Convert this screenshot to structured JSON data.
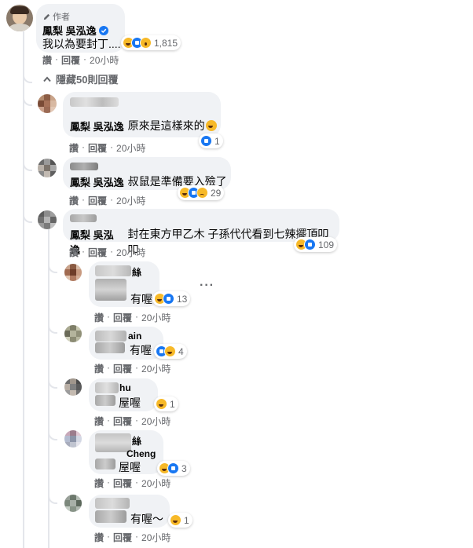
{
  "root": {
    "author_badge": "作者",
    "name": "鳳梨 吳泓逸",
    "text": "我以為要封丁....",
    "reactions": "1,815",
    "actions": {
      "like": "讚",
      "reply": "回覆",
      "time": "20小時"
    }
  },
  "hide_replies": "隱藏50則回覆",
  "comments": [
    {
      "mention": "鳳梨 吳泓逸",
      "text": "原來是這樣來的",
      "reactions": "1",
      "like": "讚",
      "reply": "回覆",
      "time": "20小時"
    },
    {
      "mention": "鳳梨 吳泓逸",
      "text": "叔鼠是準備要入殮了",
      "reactions": "29",
      "like": "讚",
      "reply": "回覆",
      "time": "20小時"
    },
    {
      "mention": "鳳梨 吳泓逸",
      "text": "封在東方甲乙木 子孫代代看到七辣擺頂叩叩",
      "reactions": "109",
      "like": "讚",
      "reply": "回覆",
      "time": "20小時"
    }
  ],
  "replies": [
    {
      "name_fragment": "絲",
      "text": "有喔",
      "reactions": "13",
      "like": "讚",
      "reply": "回覆",
      "time": "20小時"
    },
    {
      "name_fragment": "ain",
      "text": "有喔",
      "reactions": "4",
      "like": "讚",
      "reply": "回覆",
      "time": "20小時"
    },
    {
      "name_fragment": "hu",
      "text": "屋喔",
      "reactions": "1",
      "like": "讚",
      "reply": "回覆",
      "time": "20小時"
    },
    {
      "name_fragment": "絲",
      "name_fragment2": "Cheng",
      "text": "屋喔",
      "reactions": "3",
      "like": "讚",
      "reply": "回覆",
      "time": "20小時"
    },
    {
      "name_fragment": "",
      "text": "有喔～",
      "reactions": "1",
      "like": "讚",
      "reply": "回覆",
      "time": "20小時"
    }
  ],
  "colors": {
    "bubble": "#f0f2f5",
    "muted": "#65676b",
    "like_blue": "#1877f2",
    "haha_yellow": "#f7b928",
    "verified": "#1877f2"
  }
}
